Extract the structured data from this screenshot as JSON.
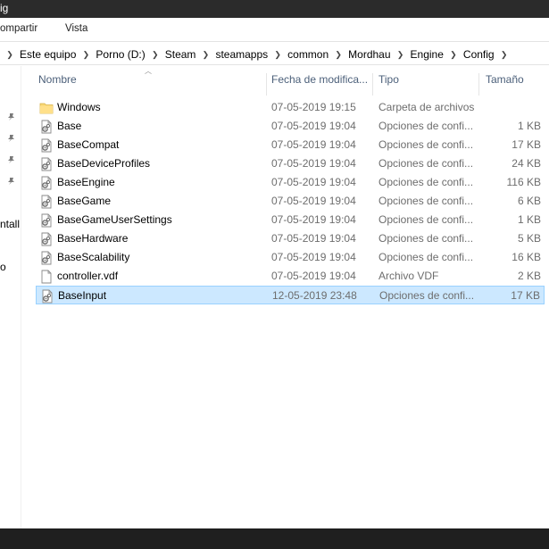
{
  "window": {
    "title": "ig"
  },
  "ribbon": {
    "tabs": [
      "ompartir",
      "Vista"
    ]
  },
  "address": {
    "crumbs": [
      "Este equipo",
      "Porno (D:)",
      "Steam",
      "steamapps",
      "common",
      "Mordhau",
      "Engine",
      "Config"
    ]
  },
  "nav": {
    "items": [
      "ntall",
      "o"
    ]
  },
  "columns": {
    "name": "Nombre",
    "date": "Fecha de modifica...",
    "type": "Tipo",
    "size": "Tamaño"
  },
  "files": [
    {
      "icon": "folder-icon",
      "name": "Windows",
      "date": "07-05-2019 19:15",
      "type": "Carpeta de archivos",
      "size": "",
      "selected": false
    },
    {
      "icon": "config-file-icon",
      "name": "Base",
      "date": "07-05-2019 19:04",
      "type": "Opciones de confi...",
      "size": "1 KB",
      "selected": false
    },
    {
      "icon": "config-file-icon",
      "name": "BaseCompat",
      "date": "07-05-2019 19:04",
      "type": "Opciones de confi...",
      "size": "17 KB",
      "selected": false
    },
    {
      "icon": "config-file-icon",
      "name": "BaseDeviceProfiles",
      "date": "07-05-2019 19:04",
      "type": "Opciones de confi...",
      "size": "24 KB",
      "selected": false
    },
    {
      "icon": "config-file-icon",
      "name": "BaseEngine",
      "date": "07-05-2019 19:04",
      "type": "Opciones de confi...",
      "size": "116 KB",
      "selected": false
    },
    {
      "icon": "config-file-icon",
      "name": "BaseGame",
      "date": "07-05-2019 19:04",
      "type": "Opciones de confi...",
      "size": "6 KB",
      "selected": false
    },
    {
      "icon": "config-file-icon",
      "name": "BaseGameUserSettings",
      "date": "07-05-2019 19:04",
      "type": "Opciones de confi...",
      "size": "1 KB",
      "selected": false
    },
    {
      "icon": "config-file-icon",
      "name": "BaseHardware",
      "date": "07-05-2019 19:04",
      "type": "Opciones de confi...",
      "size": "5 KB",
      "selected": false
    },
    {
      "icon": "config-file-icon",
      "name": "BaseScalability",
      "date": "07-05-2019 19:04",
      "type": "Opciones de confi...",
      "size": "16 KB",
      "selected": false
    },
    {
      "icon": "file-icon",
      "name": "controller.vdf",
      "date": "07-05-2019 19:04",
      "type": "Archivo VDF",
      "size": "2 KB",
      "selected": false
    },
    {
      "icon": "config-file-icon",
      "name": "BaseInput",
      "date": "12-05-2019 23:48",
      "type": "Opciones de confi...",
      "size": "17 KB",
      "selected": true
    }
  ],
  "colors": {
    "selection_bg": "#cce8ff",
    "selection_border": "#99d1ff",
    "header_text": "#4c607a",
    "folder": "#f8d775"
  }
}
